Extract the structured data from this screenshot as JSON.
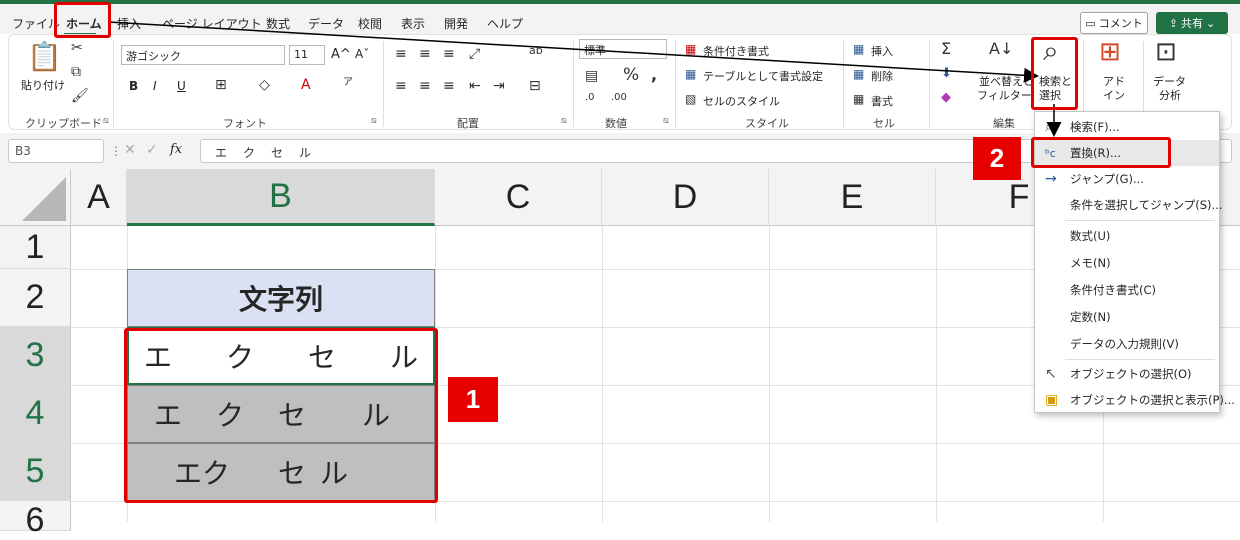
{
  "menu": {
    "items": [
      "ファイル",
      "ホーム",
      "挿入",
      "ページ レイアウト",
      "数式",
      "データ",
      "校閲",
      "表示",
      "開発",
      "ヘルプ"
    ],
    "comment": "コメント",
    "share": "共有"
  },
  "ribbon": {
    "clipboard": {
      "paste": "貼り付け",
      "label": "クリップボード"
    },
    "font": {
      "name": "游ゴシック",
      "size": "11",
      "label": "フォント",
      "bold": "B",
      "italic": "I",
      "underline": "U"
    },
    "alignment": {
      "label": "配置"
    },
    "number": {
      "format": "標準",
      "label": "数値"
    },
    "style": {
      "cond": "条件付き書式",
      "table": "テーブルとして書式設定",
      "cell": "セルのスタイル",
      "label": "スタイル"
    },
    "cells": {
      "insert": "挿入",
      "delete": "削除",
      "format": "書式",
      "label": "セル"
    },
    "edit": {
      "sort_filter_1": "並べ替えと",
      "sort_filter_2": "フィルター",
      "find_1": "検索と",
      "find_2": "選択",
      "label": "編集"
    },
    "addin": {
      "l1": "アド",
      "l2": "イン"
    },
    "analysis": {
      "l1": "データ",
      "l2": "分析"
    }
  },
  "formula_bar": {
    "name_box": "B3",
    "fx": "fx",
    "content": "エ　ク　セ　ル"
  },
  "grid": {
    "columns": [
      "A",
      "B",
      "C",
      "D",
      "E",
      "F"
    ],
    "rows": [
      "1",
      "2",
      "3",
      "4",
      "5",
      "6"
    ],
    "header_cell": "文字列",
    "cells": [
      [
        "エ",
        "ク",
        "セ",
        "ル"
      ],
      [
        "エ",
        "ク",
        "セ",
        "ル"
      ],
      [
        "エク",
        "セル"
      ]
    ]
  },
  "dropdown": {
    "items": [
      {
        "label": "検索(F)...",
        "icon": "search-icon"
      },
      {
        "label": "置換(R)...",
        "icon": "replace-icon"
      },
      {
        "label": "ジャンプ(G)...",
        "icon": "arrow-right-icon"
      },
      {
        "label": "条件を選択してジャンプ(S)..."
      },
      {
        "label": "数式(U)"
      },
      {
        "label": "メモ(N)"
      },
      {
        "label": "条件付き書式(C)"
      },
      {
        "label": "定数(N)"
      },
      {
        "label": "データの入力規則(V)"
      },
      {
        "label": "オブジェクトの選択(O)",
        "icon": "pointer-icon"
      },
      {
        "label": "オブジェクトの選択と表示(P)...",
        "icon": "selection-pane-icon"
      }
    ]
  },
  "annotations": {
    "badge1": "1",
    "badge2": "2"
  },
  "colors": {
    "excel_green": "#217346",
    "annotation_red": "#e00000",
    "header_fill": "#d9e1f2",
    "gray_fill": "#bfbfbf"
  }
}
